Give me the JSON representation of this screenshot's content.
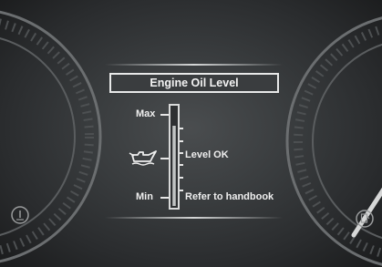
{
  "panel": {
    "title": "Engine Oil Level",
    "max_label": "Max",
    "min_label": "Min",
    "status_text": "Level OK",
    "handbook_text": "Refer to handbook",
    "oil_level_fraction": 0.82
  },
  "icons": {
    "oil_can": "oil-can-icon",
    "coolant": "coolant-temp-icon",
    "fuel": "fuel-pump-icon"
  },
  "colors": {
    "background": "#3a3d3f",
    "text": "#f3f3f3",
    "frame": "#e8e9e9"
  }
}
